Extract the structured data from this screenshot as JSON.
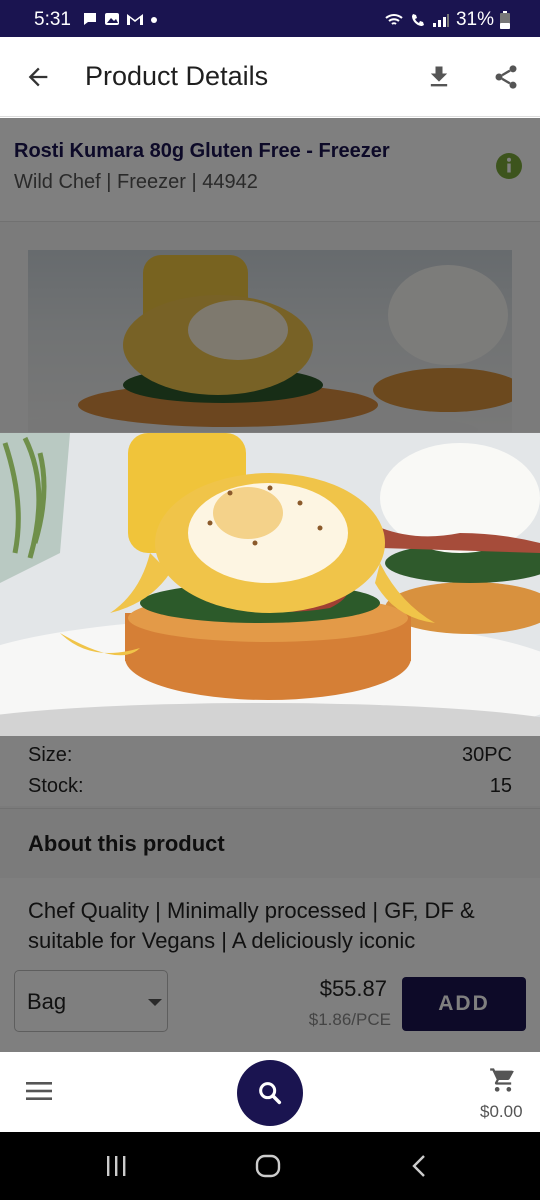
{
  "status_bar": {
    "time": "5:31",
    "battery": "31%",
    "left_icons": [
      "chat-bubble-icon",
      "image-icon",
      "gmail-icon",
      "dot-icon"
    ],
    "right_icons": [
      "wifi-calling-icon",
      "call-icon",
      "signal-icon",
      "battery-icon"
    ]
  },
  "app_bar": {
    "title": "Product Details",
    "back_icon": "arrow-back-icon",
    "download_icon": "download-icon",
    "share_icon": "share-icon"
  },
  "product": {
    "name": "Rosti Kumara 80g Gluten Free - Freezer",
    "subtitle": "Wild Chef | Freezer | 44942",
    "details": [
      {
        "label": "Size:",
        "value": "30PC"
      },
      {
        "label": "Stock:",
        "value": "15"
      }
    ],
    "about_heading": "About this product",
    "about_text": "Chef Quality | Minimally processed | GF, DF & suitable for Vegans | A deliciously iconic"
  },
  "purchase": {
    "unit": "Bag",
    "price": "$55.87",
    "unit_price": "$1.86/PCE",
    "add_label": "ADD"
  },
  "bottom_nav": {
    "cart_total": "$0.00"
  },
  "colors": {
    "brand": "#1a1450",
    "info": "#7aa83b"
  }
}
